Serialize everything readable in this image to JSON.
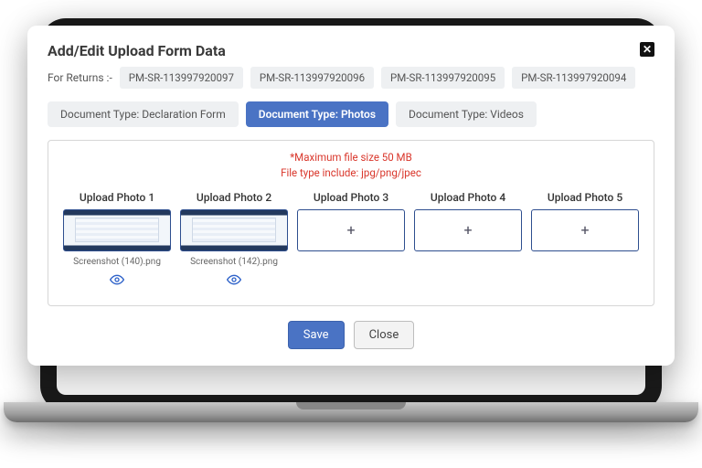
{
  "modal": {
    "title": "Add/Edit Upload Form Data",
    "returns_label": "For Returns :-",
    "returns": [
      "PM-SR-113997920097",
      "PM-SR-113997920096",
      "PM-SR-113997920095",
      "PM-SR-113997920094"
    ],
    "tabs": [
      {
        "label": "Document Type: Declaration Form"
      },
      {
        "label": "Document Type: Photos"
      },
      {
        "label": "Document Type: Videos"
      }
    ],
    "warning_line1": "*Maximum file size 50 MB",
    "warning_line2": "File type include: jpg/png/jpec",
    "slots": [
      {
        "label": "Upload Photo 1",
        "filename": "Screenshot (140).png",
        "filled": true
      },
      {
        "label": "Upload Photo 2",
        "filename": "Screenshot (142).png",
        "filled": true
      },
      {
        "label": "Upload Photo 3",
        "filename": "",
        "filled": false
      },
      {
        "label": "Upload Photo 4",
        "filename": "",
        "filled": false
      },
      {
        "label": "Upload Photo 5",
        "filename": "",
        "filled": false
      }
    ],
    "actions": {
      "save": "Save",
      "close": "Close"
    },
    "placeholder_glyph": "+"
  }
}
